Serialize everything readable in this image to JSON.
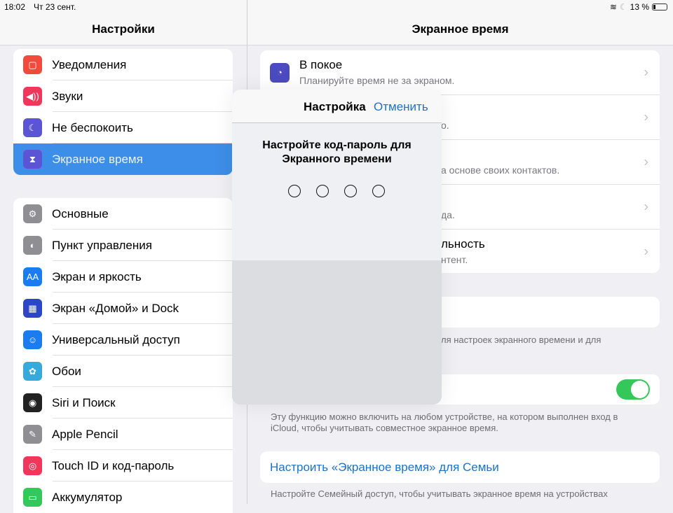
{
  "status": {
    "time": "18:02",
    "date": "Чт 23 сент.",
    "battery": "13 %",
    "battery_level": 13
  },
  "sidebar": {
    "title": "Настройки",
    "group1": [
      {
        "label": "Уведомления",
        "icon": "notifications-icon",
        "color": "#f04b3c"
      },
      {
        "label": "Звуки",
        "icon": "sounds-icon",
        "color": "#f0365a"
      },
      {
        "label": "Не беспокоить",
        "icon": "moon-icon",
        "color": "#5b55d6"
      },
      {
        "label": "Экранное время",
        "icon": "hourglass-icon",
        "color": "#5b55d6",
        "selected": true
      }
    ],
    "group2": [
      {
        "label": "Основные",
        "icon": "gear-icon",
        "color": "#8e8e93"
      },
      {
        "label": "Пункт управления",
        "icon": "switches-icon",
        "color": "#8e8e93"
      },
      {
        "label": "Экран и яркость",
        "icon": "display-icon",
        "color": "#1a7cf0"
      },
      {
        "label": "Экран «Домой» и Dock",
        "icon": "home-grid-icon",
        "color": "#2b46c8"
      },
      {
        "label": "Универсальный доступ",
        "icon": "accessibility-icon",
        "color": "#1a7cf0"
      },
      {
        "label": "Обои",
        "icon": "wallpaper-icon",
        "color": "#36aadc"
      },
      {
        "label": "Siri и Поиск",
        "icon": "siri-icon",
        "color": "#222"
      },
      {
        "label": "Apple Pencil",
        "icon": "pencil-icon",
        "color": "#8e8e93"
      },
      {
        "label": "Touch ID и код-пароль",
        "icon": "fingerprint-icon",
        "color": "#f0365a"
      },
      {
        "label": "Аккумулятор",
        "icon": "battery-icon",
        "color": "#34c759"
      }
    ]
  },
  "main": {
    "title": "Экранное время",
    "downtime": {
      "title": "В покое",
      "subtitle": "Планируйте время не за экраном."
    },
    "row_fragments": [
      {
        "sub": "о."
      },
      {
        "sub": "а основе своих контактов."
      },
      {
        "sub": "да."
      },
      {
        "title": "льность",
        "sub": "нтент."
      }
    ],
    "footer1": "ля настроек экранного времени и для",
    "share_toggle_on": true,
    "footer2": "Эту функцию можно включить на любом устройстве, на котором выполнен вход в iCloud, чтобы учитывать совместное экранное время.",
    "family_link": "Настроить «Экранное время» для Семьи",
    "footer3": "Настройте Семейный доступ, чтобы учитывать экранное время на устройствах"
  },
  "modal": {
    "title": "Настройка",
    "cancel": "Отменить",
    "prompt_line1": "Настройте код-пароль для",
    "prompt_line2": "Экранного времени",
    "digits_entered": 0
  },
  "colors": {
    "accent": "#1a73c8",
    "selected": "#3d8ee8",
    "toggle": "#34c759"
  }
}
